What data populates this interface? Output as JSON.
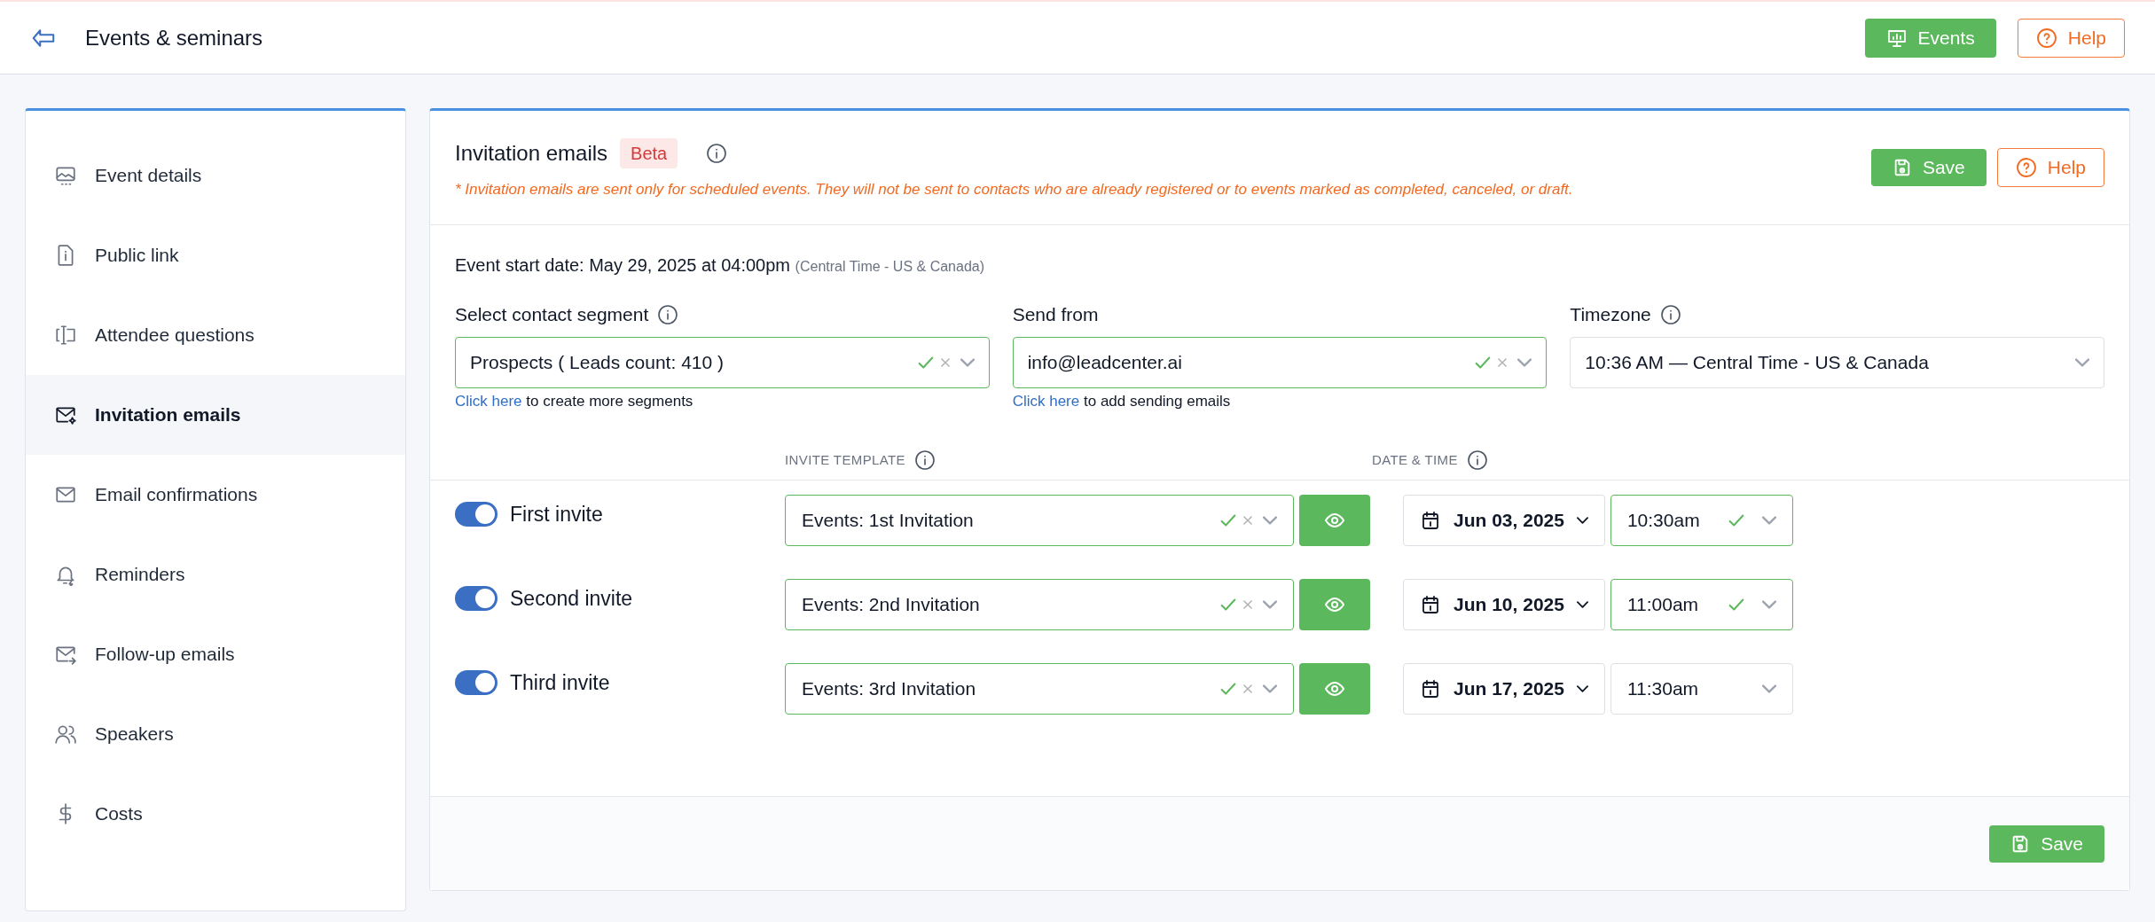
{
  "header": {
    "title": "Events & seminars",
    "events_button": "Events",
    "help_button": "Help"
  },
  "sidebar": {
    "items": [
      {
        "label": "Event details",
        "selected": false
      },
      {
        "label": "Public link",
        "selected": false
      },
      {
        "label": "Attendee questions",
        "selected": false
      },
      {
        "label": "Invitation emails",
        "selected": true
      },
      {
        "label": "Email confirmations",
        "selected": false
      },
      {
        "label": "Reminders",
        "selected": false
      },
      {
        "label": "Follow-up emails",
        "selected": false
      },
      {
        "label": "Speakers",
        "selected": false
      },
      {
        "label": "Costs",
        "selected": false
      }
    ]
  },
  "panel": {
    "title": "Invitation emails",
    "badge": "Beta",
    "note": "* Invitation emails are sent only for scheduled events. They will not be sent to contacts who are already registered or to events marked as completed, canceled, or draft.",
    "save_button": "Save",
    "help_button": "Help",
    "event_start": {
      "label": "Event start date:",
      "value": "May 29, 2025 at 04:00pm",
      "timezone": "(Central Time - US & Canada)"
    },
    "fields": [
      {
        "label": "Select contact segment",
        "info": true,
        "value": "Prospects ( Leads count: 410 )",
        "valid": true,
        "link": "Click here",
        "hint": "to create more segments"
      },
      {
        "label": "Send from",
        "info": false,
        "value": "info@leadcenter.ai",
        "valid": true,
        "link": "Click here",
        "hint": "to add sending emails"
      },
      {
        "label": "Timezone",
        "info": true,
        "value": "10:36 AM — Central Time - US & Canada",
        "valid": false
      }
    ],
    "columns": [
      "INVITE TEMPLATE",
      "DATE & TIME"
    ],
    "invites": [
      {
        "label": "First invite",
        "on": true,
        "template": "Events: 1st Invitation",
        "date": "Jun 03, 2025",
        "time": "10:30am",
        "time_valid": true
      },
      {
        "label": "Second invite",
        "on": true,
        "template": "Events: 2nd Invitation",
        "date": "Jun 10, 2025",
        "time": "11:00am",
        "time_valid": true
      },
      {
        "label": "Third invite",
        "on": true,
        "template": "Events: 3rd Invitation",
        "date": "Jun 17, 2025",
        "time": "11:30am",
        "time_valid": false
      }
    ],
    "footer_save_button": "Save"
  }
}
